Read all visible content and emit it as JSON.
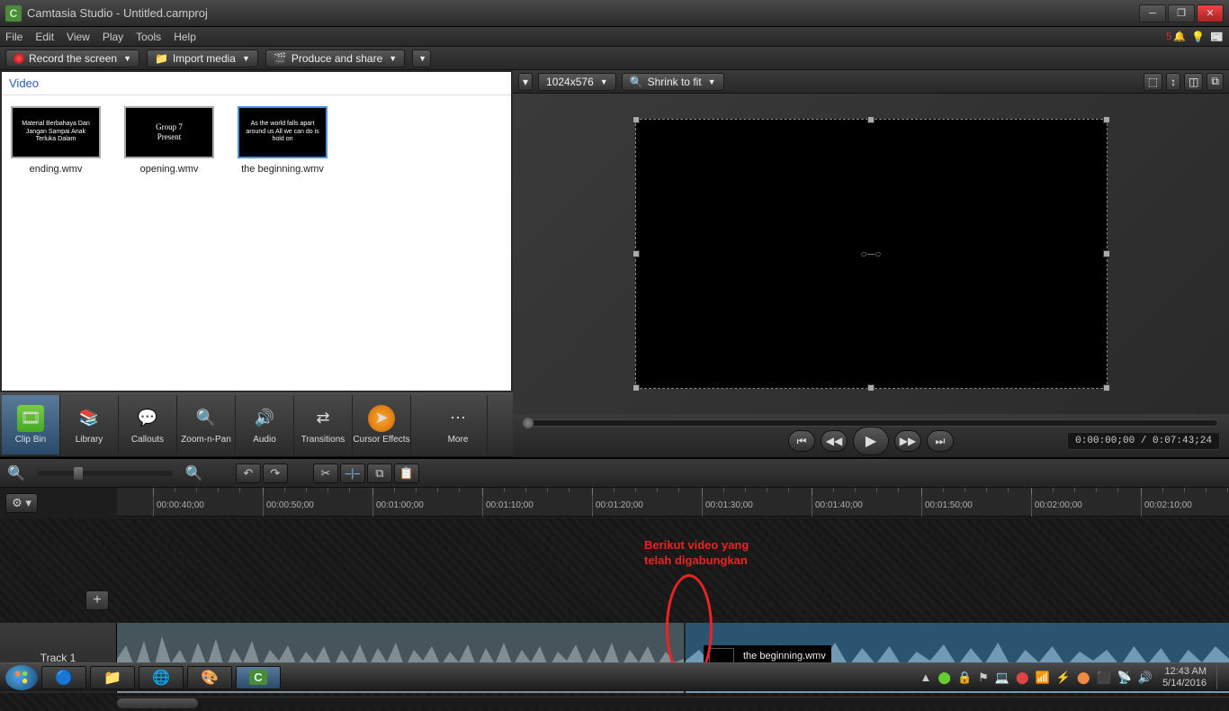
{
  "titlebar": {
    "app": "Camtasia Studio",
    "doc": "Untitled.camproj"
  },
  "menu": {
    "file": "File",
    "edit": "Edit",
    "view": "View",
    "play": "Play",
    "tools": "Tools",
    "help": "Help",
    "count": "5"
  },
  "toolbar": {
    "record": "Record the screen",
    "import": "Import media",
    "produce": "Produce and share"
  },
  "preview": {
    "dims": "1024x576",
    "shrink": "Shrink to fit",
    "time": "0:00:00;00 / 0:07:43;24"
  },
  "clipbin": {
    "title": "Video",
    "clips": [
      {
        "name": "ending.wmv",
        "text": "Material Berbahaya Dan Jangan Sampai Anak Terluka Dalam"
      },
      {
        "name": "opening.wmv",
        "text": "Group 7\nPresent"
      },
      {
        "name": "the beginning.wmv",
        "text": "As the world falls apart around us\nAll we can do is hold on"
      }
    ]
  },
  "tools": {
    "clipbin": "Clip Bin",
    "library": "Library",
    "callouts": "Callouts",
    "zoom": "Zoom-n-Pan",
    "audio": "Audio",
    "transitions": "Transitions",
    "cursor": "Cursor Effects",
    "more": "More"
  },
  "timeline": {
    "marks": [
      "00:00:40;00",
      "00:00:50;00",
      "00:01:00;00",
      "00:01:10;00",
      "00:01:20;00",
      "00:01:30;00",
      "00:01:40;00",
      "00:01:50;00",
      "00:02:00;00",
      "00:02:10;00"
    ],
    "track": "Track 1",
    "clip2": "the beginning.wmv"
  },
  "annotation": {
    "text": "Berikut video yang\ntelah digabungkan"
  },
  "taskbar": {
    "time": "12:43 AM",
    "date": "5/14/2016"
  },
  "controls_time": "0:00:00;00 / 0:07:43;24"
}
